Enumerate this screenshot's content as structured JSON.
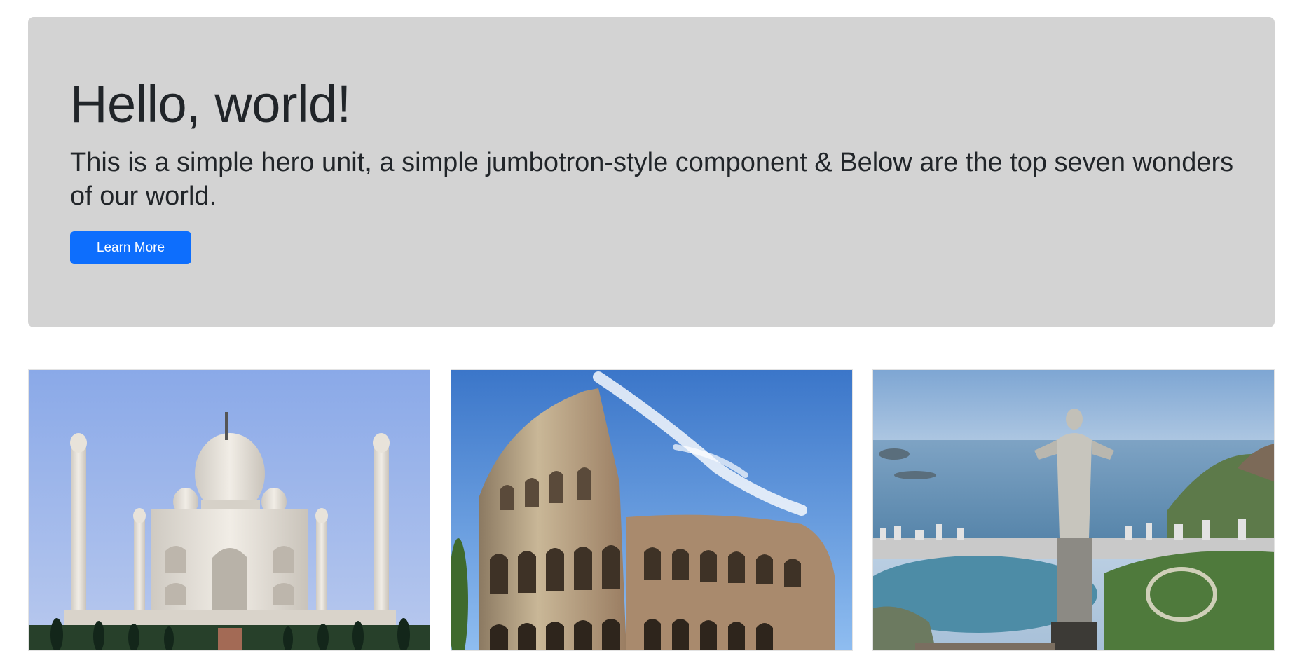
{
  "hero": {
    "title": "Hello, world!",
    "lead": "This is a simple hero unit, a simple jumbotron-style component & Below are the top seven wonders of our world.",
    "button_label": "Learn More"
  },
  "cards": [
    {
      "subject": "Taj Mahal"
    },
    {
      "subject": "Colosseum"
    },
    {
      "subject": "Christ the Redeemer"
    }
  ],
  "colors": {
    "hero_bg": "#d3d3d3",
    "button_bg": "#0d6efd",
    "button_text": "#ffffff",
    "text": "#212529"
  }
}
